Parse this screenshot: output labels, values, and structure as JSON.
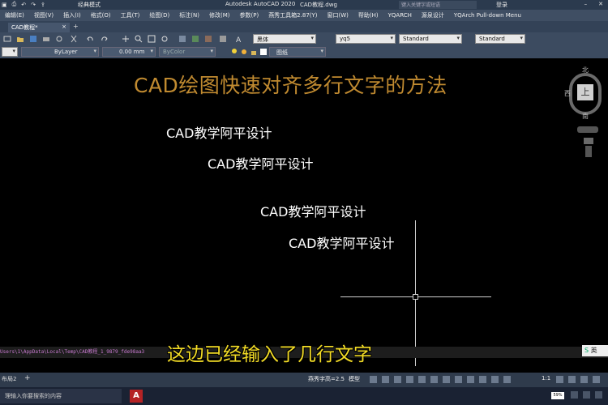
{
  "titlebar": {
    "workspace": "经典模式",
    "app_title": "Autodesk AutoCAD 2020",
    "doc_title": "CAD教程.dwg",
    "search_placeholder": "键入关键字或短语",
    "login": "登录"
  },
  "menu": [
    "编辑(E)",
    "视图(V)",
    "插入(I)",
    "格式(O)",
    "工具(T)",
    "绘图(D)",
    "标注(N)",
    "修改(M)",
    "参数(P)",
    "燕秀工具箱2.87(Y)",
    "窗口(W)",
    "帮助(H)",
    "YQARCH",
    "源泉设计",
    "YQArch Pull-down Menu"
  ],
  "tabs": {
    "active": "CAD教程*"
  },
  "toolbar1": {
    "font": "黑体",
    "style": "yq5",
    "dimstyle1": "Standard",
    "dimstyle2": "Standard"
  },
  "toolbar2": {
    "linetype": "ByLayer",
    "lineweight": "0.00 mm",
    "color": "ByColor",
    "layer": "图纸"
  },
  "drawing": {
    "title": "CAD绘图快速对齐多行文字的方法",
    "lines": [
      "CAD教学阿平设计",
      "CAD教学阿平设计",
      "CAD教学阿平设计",
      "CAD教学阿平设计"
    ]
  },
  "viewcube": {
    "north": "北",
    "west": "西",
    "south": "南",
    "face": "上"
  },
  "cmdline": {
    "path": "Users\\1\\AppData\\Local\\Temp\\CAD教程_1_9879_fde98aa3",
    "subtitle": "这边已经输入了几行文字",
    "ime": "英"
  },
  "status": {
    "layout": "布局2",
    "scale": "燕秀字高=2.5",
    "model": "模型",
    "ratio": "1:1"
  },
  "taskbar": {
    "search": "理输入你要搜索的内容",
    "acad_letter": "A",
    "battery": "59%"
  }
}
